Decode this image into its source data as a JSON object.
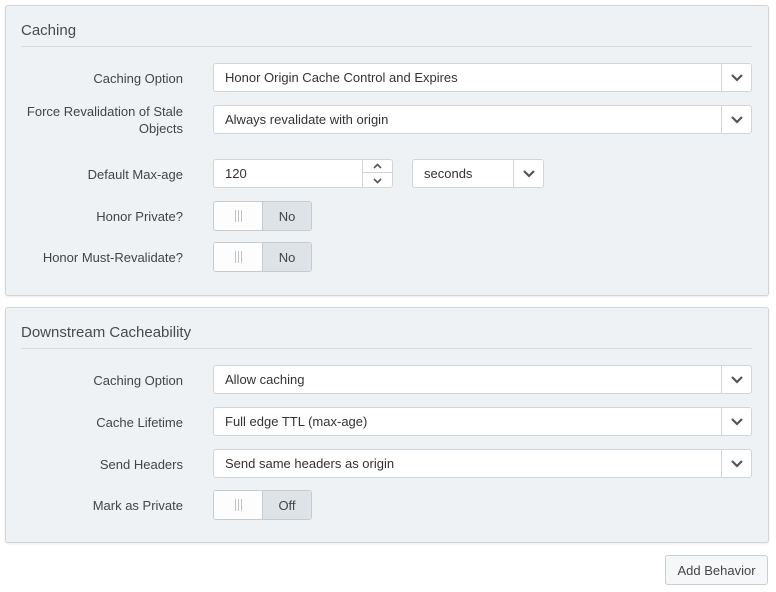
{
  "caching": {
    "title": "Caching",
    "caching_option": {
      "label": "Caching Option",
      "value": "Honor Origin Cache Control and Expires"
    },
    "force_revalidation": {
      "label": "Force Revalidation of Stale Objects",
      "value": "Always revalidate with origin"
    },
    "default_max_age": {
      "label": "Default Max-age",
      "value": "120",
      "unit": "seconds"
    },
    "honor_private": {
      "label": "Honor Private?",
      "state": "No"
    },
    "honor_must_revalidate": {
      "label": "Honor Must-Revalidate?",
      "state": "No"
    }
  },
  "downstream": {
    "title": "Downstream Cacheability",
    "caching_option": {
      "label": "Caching Option",
      "value": "Allow caching"
    },
    "cache_lifetime": {
      "label": "Cache Lifetime",
      "value": "Full edge TTL (max-age)"
    },
    "send_headers": {
      "label": "Send Headers",
      "value": "Send same headers as origin"
    },
    "mark_private": {
      "label": "Mark as Private",
      "state": "Off"
    }
  },
  "footer": {
    "add_behavior_label": "Add Behavior"
  },
  "icons": {
    "dropdown": "chevron-down-icon",
    "increment": "chevron-up-icon",
    "decrement": "chevron-down-icon",
    "toggle_grip": "grip-icon"
  }
}
